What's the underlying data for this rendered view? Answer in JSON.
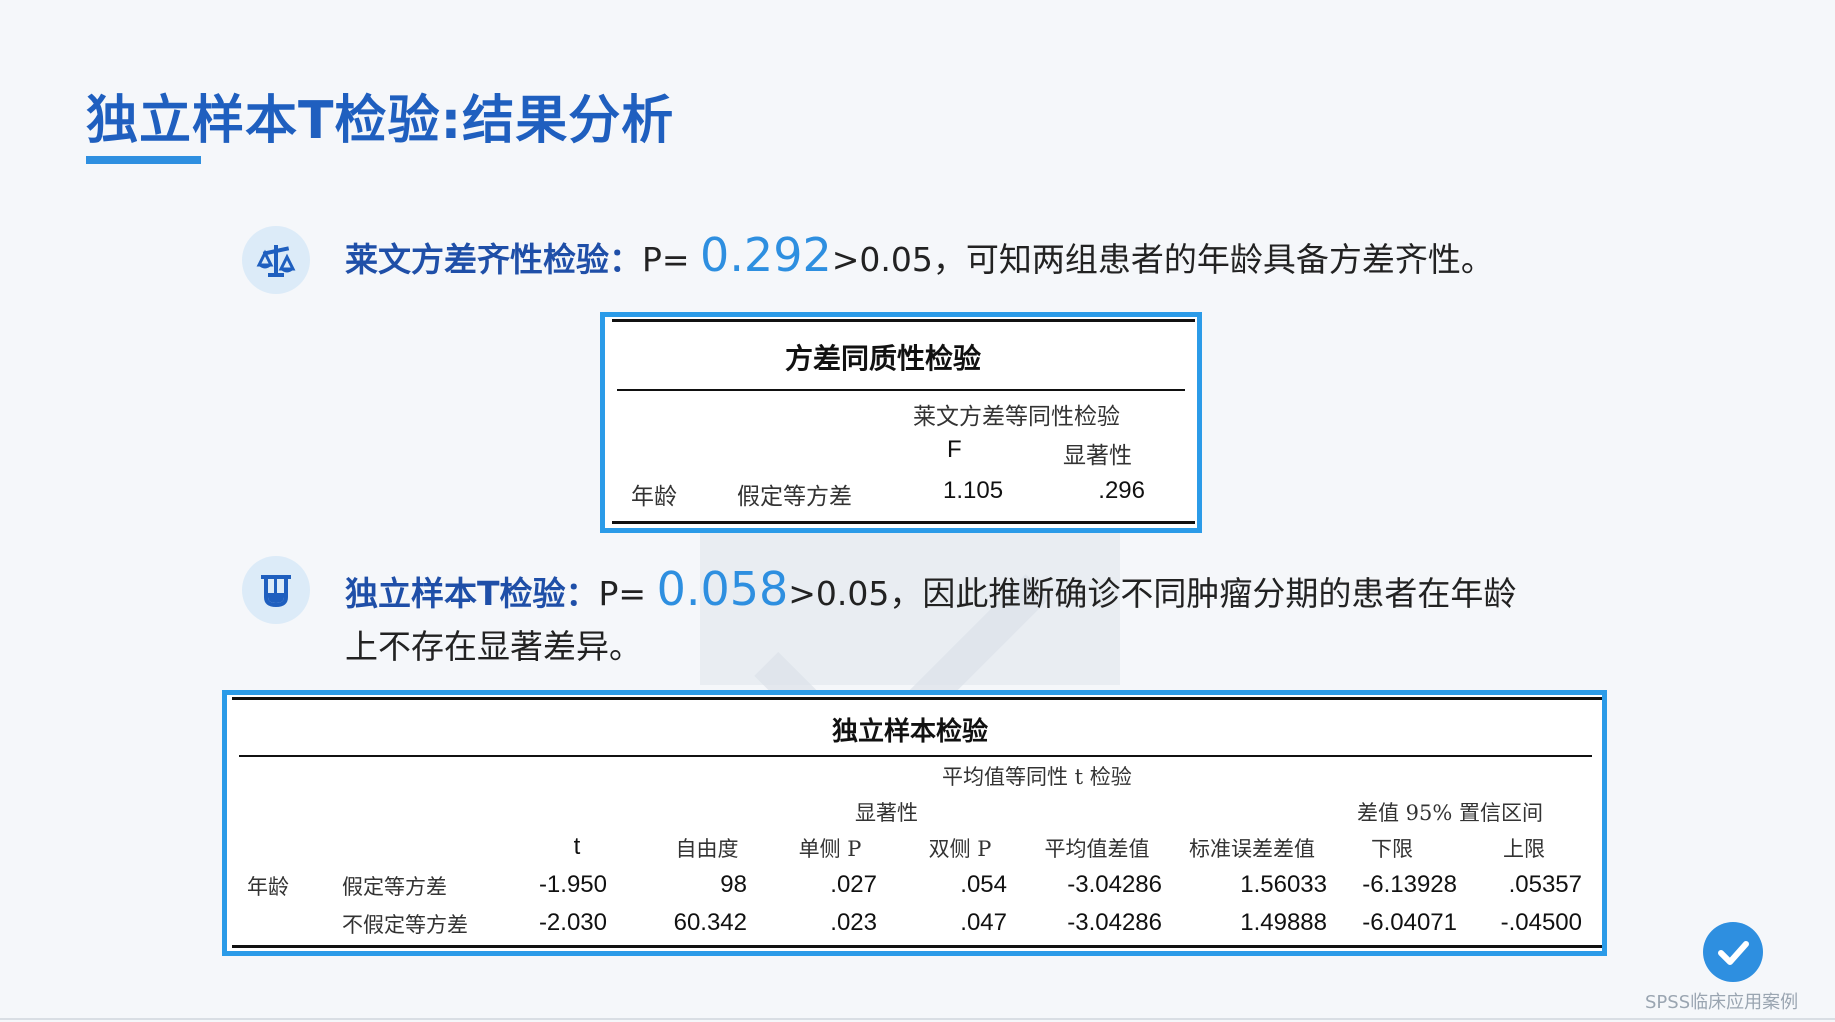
{
  "title": "独立样本T检验:结果分析",
  "levene": {
    "label": "莱文方差齐性检验",
    "colon": "：",
    "p_prefix": "P= ",
    "p_value": "0.292",
    "rest": ">0.05，可知两组患者的年龄具备方差齐性。"
  },
  "ttest": {
    "label": "独立样本T检验",
    "colon": "：",
    "p_prefix": "P= ",
    "p_value": "0.058",
    "rest_line1": ">0.05，因此推断确诊不同肿瘤分期的患者在年龄",
    "rest_line2": "上不存在显著差异。"
  },
  "table1": {
    "title": "方差同质性检验",
    "group_header": "莱文方差等同性检验",
    "col_f": "F",
    "col_sig": "显著性",
    "row_label": "年龄",
    "row_sub": "假定等方差",
    "f": "1.105",
    "sig": ".296"
  },
  "table2": {
    "title": "独立样本检验",
    "group_header": "平均值等同性 t 检验",
    "sig_header": "显著性",
    "ci_header": "差值 95% 置信区间",
    "columns": [
      "t",
      "自由度",
      "单侧 P",
      "双侧 P",
      "平均值差值",
      "标准误差差值",
      "下限",
      "上限"
    ],
    "row_label": "年龄",
    "rows": [
      {
        "sub": "假定等方差",
        "values": [
          "-1.950",
          "98",
          ".027",
          ".054",
          "-3.04286",
          "1.56033",
          "-6.13928",
          ".05357"
        ]
      },
      {
        "sub": "不假定等方差",
        "values": [
          "-2.030",
          "60.342",
          ".023",
          ".047",
          "-3.04286",
          "1.49888",
          "-6.04071",
          "-.04500"
        ]
      }
    ]
  },
  "footer": "SPSS临床应用案例",
  "colors": {
    "accent": "#2e8fe0",
    "title": "#1f5fbf",
    "frame": "#2b9be8"
  }
}
